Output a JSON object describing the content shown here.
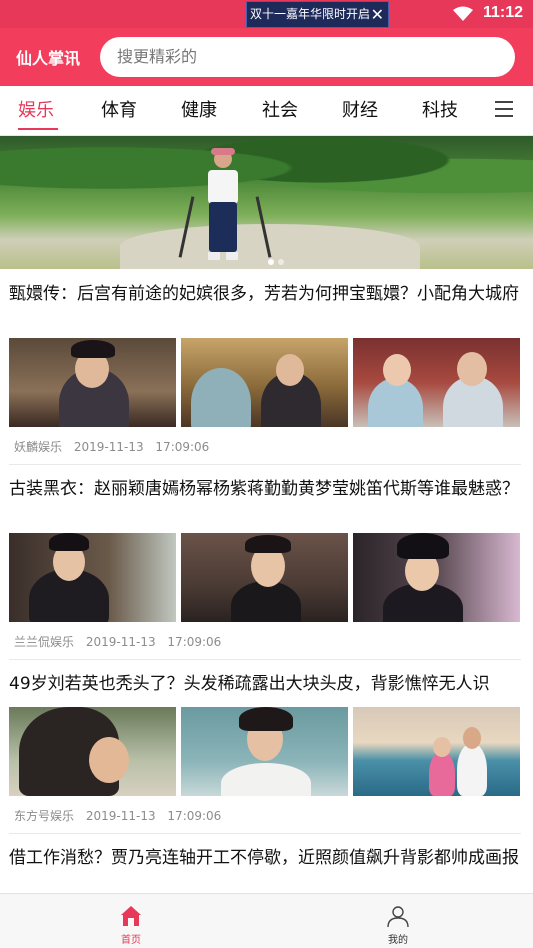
{
  "status_bar": {
    "notification_text": "双十一嘉年华限时开启",
    "close_glyph": "✕",
    "time": "11:12",
    "icons": [
      "wifi-icon"
    ]
  },
  "header": {
    "brand": "仙人掌讯",
    "search_placeholder": "搜更精彩的"
  },
  "tabs": [
    {
      "label": "娱乐",
      "active": true
    },
    {
      "label": "体育",
      "active": false
    },
    {
      "label": "健康",
      "active": false
    },
    {
      "label": "社会",
      "active": false
    },
    {
      "label": "财经",
      "active": false
    },
    {
      "label": "科技",
      "active": false
    }
  ],
  "banner": {
    "slide_count": 2,
    "active_slide": 1
  },
  "articles": [
    {
      "title": "甄嬛传：后宫有前途的妃嫔很多，芳若为何押宝甄嬛？小配角大城府",
      "source": "妖麟娱乐",
      "date": "2019-11-13",
      "time": "17:09:06"
    },
    {
      "title": "古装黑衣：赵丽颖唐嫣杨幂杨紫蒋勤勤黄梦莹姚笛代斯等谁最魅惑？",
      "source": "兰兰侃娱乐",
      "date": "2019-11-13",
      "time": "17:09:06"
    },
    {
      "title": "49岁刘若英也秃头了？头发稀疏露出大块头皮，背影憔悴无人识",
      "source": "东方号娱乐",
      "date": "2019-11-13",
      "time": "17:09:06"
    },
    {
      "title": "借工作消愁？贾乃亮连轴开工不停歇，近照颜值飙升背影都帅成画报"
    }
  ],
  "bottom_nav": [
    {
      "label": "首页",
      "icon": "home-icon",
      "active": true
    },
    {
      "label": "我的",
      "icon": "user-icon",
      "active": false
    }
  ],
  "colors": {
    "accent": "#f23e5c",
    "active_tab": "#e8385a",
    "meta_text": "#8c8c8c"
  }
}
